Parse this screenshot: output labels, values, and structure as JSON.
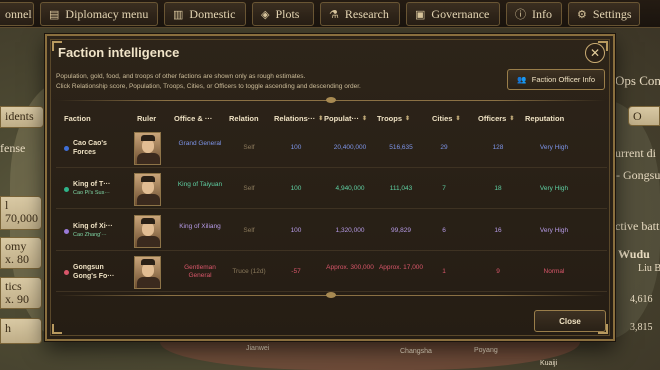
{
  "topbar": {
    "buttons": [
      {
        "label": "onnel",
        "icon": ""
      },
      {
        "label": "Diplomacy menu",
        "icon": "▤"
      },
      {
        "label": "Domestic",
        "icon": "▥"
      },
      {
        "label": "Plots",
        "icon": "◈"
      },
      {
        "label": "Research",
        "icon": "⚗"
      },
      {
        "label": "Governance",
        "icon": "▣"
      },
      {
        "label": "Info",
        "icon": "ⓘ"
      },
      {
        "label": "Settings",
        "icon": "⚙"
      }
    ]
  },
  "left_panel": {
    "items": [
      "idents",
      "fense",
      "",
      "l",
      "70,000",
      "omy",
      "x. 80",
      "tics",
      "x. 90",
      "h"
    ]
  },
  "right_panel": {
    "labels": [
      "Ops Con",
      "O",
      "urrent di",
      "- Gongsu",
      "ctive batt",
      "Wudu",
      "Liu B",
      "4,616",
      "3,815"
    ]
  },
  "map_labels": [
    "Jianwei",
    "Changsha",
    "Poyang",
    "Kuaiji"
  ],
  "dialog": {
    "title": "Faction intelligence",
    "description_line1": "Population, gold, food, and troops of other factions are shown only as rough estimates.",
    "description_line2": "Click Relationship score, Population, Troops, Cities, or Officers to toggle ascending and descending order.",
    "officer_button": "Faction Officer Info",
    "close_button": "Close",
    "columns": [
      "Faction",
      "Ruler",
      "Office & ···",
      "Relation",
      "Relations···",
      "Populat···",
      "Troops",
      "Cities",
      "Officers",
      "Reputation"
    ],
    "rows": [
      {
        "faction": "Cao Cao's Forces",
        "ruler_sub": "",
        "office": "Grand General",
        "relation": "Self",
        "relations_score": "100",
        "population": "20,400,000",
        "troops": "516,635",
        "cities": "29",
        "officers": "128",
        "reputation": "Very High",
        "color": "#3f6fd6",
        "text_color": "#7d95e8"
      },
      {
        "faction": "King of T···",
        "ruler_sub": "Cao Pi's Sus···",
        "office": "King of Taiyuan",
        "relation": "Self",
        "relations_score": "100",
        "population": "4,940,000",
        "troops": "111,043",
        "cities": "7",
        "officers": "18",
        "reputation": "Very High",
        "color": "#2fb48a",
        "text_color": "#5fd0a3"
      },
      {
        "faction": "King of Xi···",
        "ruler_sub": "Cao Zhang'···",
        "office": "King of Xiliang",
        "relation": "Self",
        "relations_score": "100",
        "population": "1,320,000",
        "troops": "99,829",
        "cities": "6",
        "officers": "16",
        "reputation": "Very High",
        "color": "#9a7ad8",
        "text_color": "#b69be6"
      },
      {
        "faction": "Gongsun Gong's Fo···",
        "ruler_sub": "",
        "office": "Gentleman General",
        "relation": "Truce (12d)",
        "relations_score": "-57",
        "population": "Approx. 300,000",
        "troops": "Approx. 17,000",
        "cities": "1",
        "officers": "9",
        "reputation": "Normal",
        "color": "#d9566a",
        "text_color": "#d9566a"
      }
    ]
  }
}
